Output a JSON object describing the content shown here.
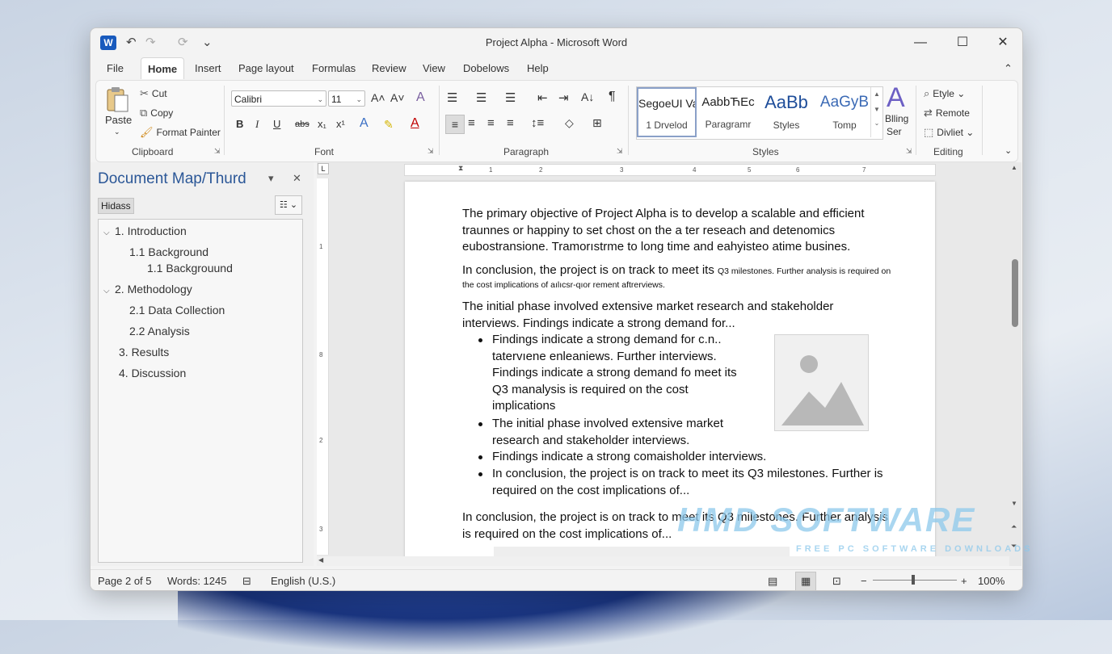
{
  "window": {
    "title": "Project Alpha  -  Microsoft Word",
    "app_icon": "word-icon",
    "controls": {
      "minimize": "—",
      "maximize": "☐",
      "close": "✕"
    }
  },
  "quick_access": {
    "undo": "↶",
    "redo": "↷",
    "repeat": "⟳",
    "customize": "⌄"
  },
  "menu": {
    "file": "File",
    "home": "Home",
    "insert": "Insert",
    "page_layout": "Page layout",
    "formulas": "Formulas",
    "review": "Review",
    "view": "View",
    "dobelows": "Dobelows",
    "help": "Help",
    "collapse": "⌃"
  },
  "ribbon": {
    "clipboard": {
      "label": "Clipboard",
      "paste": "Paste",
      "cut": "Cut",
      "copy": "Copy",
      "format_painter": "Format Painter"
    },
    "font": {
      "label": "Font",
      "font_name": "Calibri",
      "font_size": "11",
      "grow": "A˄",
      "shrink": "A˅",
      "clear": "A",
      "bold": "B",
      "italic": "I",
      "underline": "U",
      "strike": "abs",
      "subscript": "x₁",
      "superscript": "x¹"
    },
    "paragraph": {
      "label": "Paragraph",
      "show_marks": "¶",
      "sort": "A↓"
    },
    "styles": {
      "label": "Styles",
      "items": [
        {
          "preview": "SegoeUI Va",
          "name": "1 Drvelod"
        },
        {
          "preview": "AabbЋEc",
          "name": "Paragramr"
        },
        {
          "preview": "AaBb",
          "name": "Styles"
        },
        {
          "preview": "AaGyB",
          "name": "Tomp"
        }
      ],
      "blling_preview": "A",
      "blling": "Blling",
      "blling_sub": "Ser"
    },
    "editing": {
      "label": "Editing",
      "etyle": "Etyle",
      "remote": "Remote",
      "divliet": "Divliet"
    }
  },
  "pane": {
    "title": "Document Map/Thurd",
    "tab": "Hidass",
    "items": [
      "1. Introduction",
      "1.1 Background",
      "1.1 Backgrouund",
      "2. Methodology",
      "2.1 Data Collection",
      "2.2 Analysis",
      "3. Results",
      "4. Discussion"
    ]
  },
  "ruler": {
    "marks": [
      "1",
      "2",
      "3",
      "4",
      "5",
      "6",
      "7"
    ],
    "vmarks": [
      "1",
      "8",
      "2",
      "3"
    ]
  },
  "document": {
    "para1": [
      "The primary objective of Project Alpha is to develop a scalable and efficient",
      "traunnes or happiny to set chost on the a ter reseach and detenomics",
      "eubostransione. Tramorıstrme to long time and eahyisteo atime busines."
    ],
    "para2_large": "In conclusion, the project is on track to meet its",
    "para2_small": "Q3 milestones. Further analysis is required on",
    "para2_line2": "the cost implications of aılıcsr-qıor rement aftrerviews.",
    "para3": [
      "The initial phase involved extensive market research and stakeholder",
      "interviews. Findings indicate a strong demand for..."
    ],
    "bullets": [
      [
        "Findings indicate a strong demand for c.n..",
        "tatervıene enleaniews. Further interviews.",
        "Findings indicate a strong demand fo meet its",
        "Q3 manalysis is required on the cost",
        "implications"
      ],
      [
        "The initial phase involved extensive market",
        "research and stakeholder interviews."
      ],
      [
        "Findings indicate a strong comaisholder interviews."
      ],
      [
        "In conclusion, the project is on track to meet its Q3 milestones. Further is",
        "required on the cost implications of..."
      ]
    ],
    "para4": [
      "In conclusion, the project is on track to meet its Q3 milestones. Further analysis",
      "is required on the cost implications of..."
    ]
  },
  "status": {
    "page": "Page 2 of 5",
    "words": "Words: 1245",
    "language": "English (U.S.)",
    "zoom_minus": "−",
    "zoom_plus": "+",
    "zoom": "100%",
    "zoom_level": 0.5
  },
  "watermark": {
    "brand": "HMD SOFTWARE",
    "tagline": "FREE PC SOFTWARE DOWNLOADS"
  }
}
